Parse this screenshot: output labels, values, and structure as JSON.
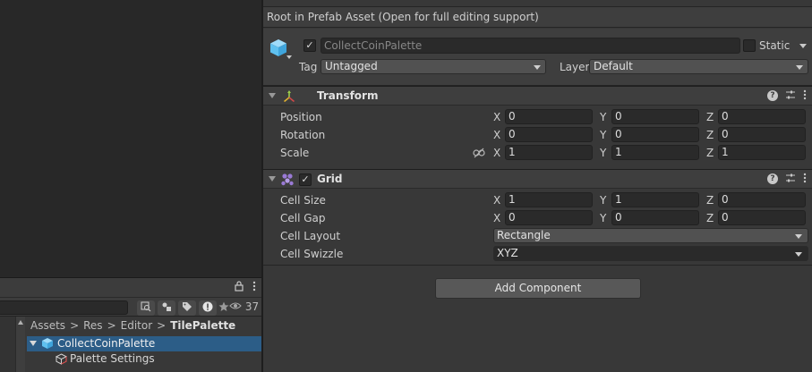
{
  "project": {
    "visible_count": "37",
    "breadcrumb": [
      "Assets",
      "Res",
      "Editor",
      "TilePalette"
    ],
    "breadcrumb_sep": ">",
    "assets": [
      {
        "name": "CollectCoinPalette"
      },
      {
        "name": "Palette Settings"
      }
    ]
  },
  "inspector": {
    "prefab_notice": "Root in Prefab Asset (Open for full editing support)",
    "gameobject": {
      "name": "CollectCoinPalette",
      "active": true,
      "static_label": "Static",
      "static_checked": false,
      "tag_label": "Tag",
      "tag_value": "Untagged",
      "layer_label": "Layer",
      "layer_value": "Default"
    },
    "transform": {
      "title": "Transform",
      "rows": [
        {
          "label": "Position",
          "x": "0",
          "y": "0",
          "z": "0"
        },
        {
          "label": "Rotation",
          "x": "0",
          "y": "0",
          "z": "0"
        },
        {
          "label": "Scale",
          "x": "1",
          "y": "1",
          "z": "1"
        }
      ]
    },
    "grid": {
      "title": "Grid",
      "enabled": true,
      "rows": [
        {
          "label": "Cell Size",
          "x": "1",
          "y": "1",
          "z": "0"
        },
        {
          "label": "Cell Gap",
          "x": "0",
          "y": "0",
          "z": "0"
        }
      ],
      "cell_layout_label": "Cell Layout",
      "cell_layout_value": "Rectangle",
      "cell_swizzle_label": "Cell Swizzle",
      "cell_swizzle_value": "XYZ"
    },
    "axes": {
      "x": "X",
      "y": "Y",
      "z": "Z"
    },
    "add_component_label": "Add Component"
  },
  "colors": {
    "selection": "#2c5d87",
    "panel": "#383838",
    "header": "#3e3e3e",
    "field": "#2a2a2a",
    "cube_icon": "#5fc1f0",
    "grid_icon": "#9a7ad6"
  }
}
